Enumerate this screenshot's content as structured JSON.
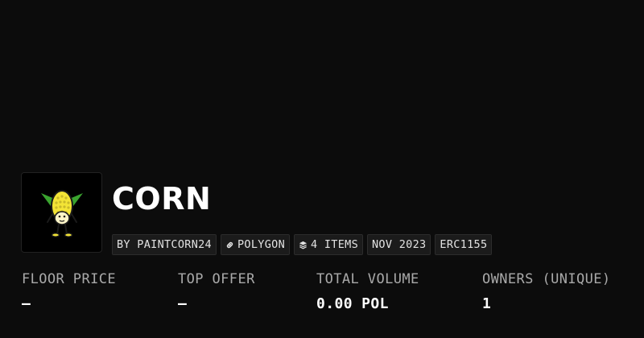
{
  "collection": {
    "title": "CORN",
    "avatar_icon": "corn-character-icon",
    "meta": {
      "creator": "BY PAINTCORN24",
      "chain": "POLYGON",
      "chain_icon": "link-icon",
      "items": "4 ITEMS",
      "items_icon": "layers-icon",
      "date": "NOV 2023",
      "standard": "ERC1155"
    }
  },
  "stats": {
    "floor_price": {
      "label": "FLOOR PRICE",
      "value": "—"
    },
    "top_offer": {
      "label": "TOP OFFER",
      "value": "—"
    },
    "total_volume": {
      "label": "TOTAL VOLUME",
      "value": "0.00 POL"
    },
    "owners": {
      "label": "OWNERS (UNIQUE)",
      "value": "1"
    }
  },
  "colors": {
    "background": "#0c0c0c",
    "chip_background": "#1b1b1b",
    "label_gray": "#a9a9a9",
    "corn_yellow": "#f3e436",
    "husk_green": "#3aa32f"
  }
}
